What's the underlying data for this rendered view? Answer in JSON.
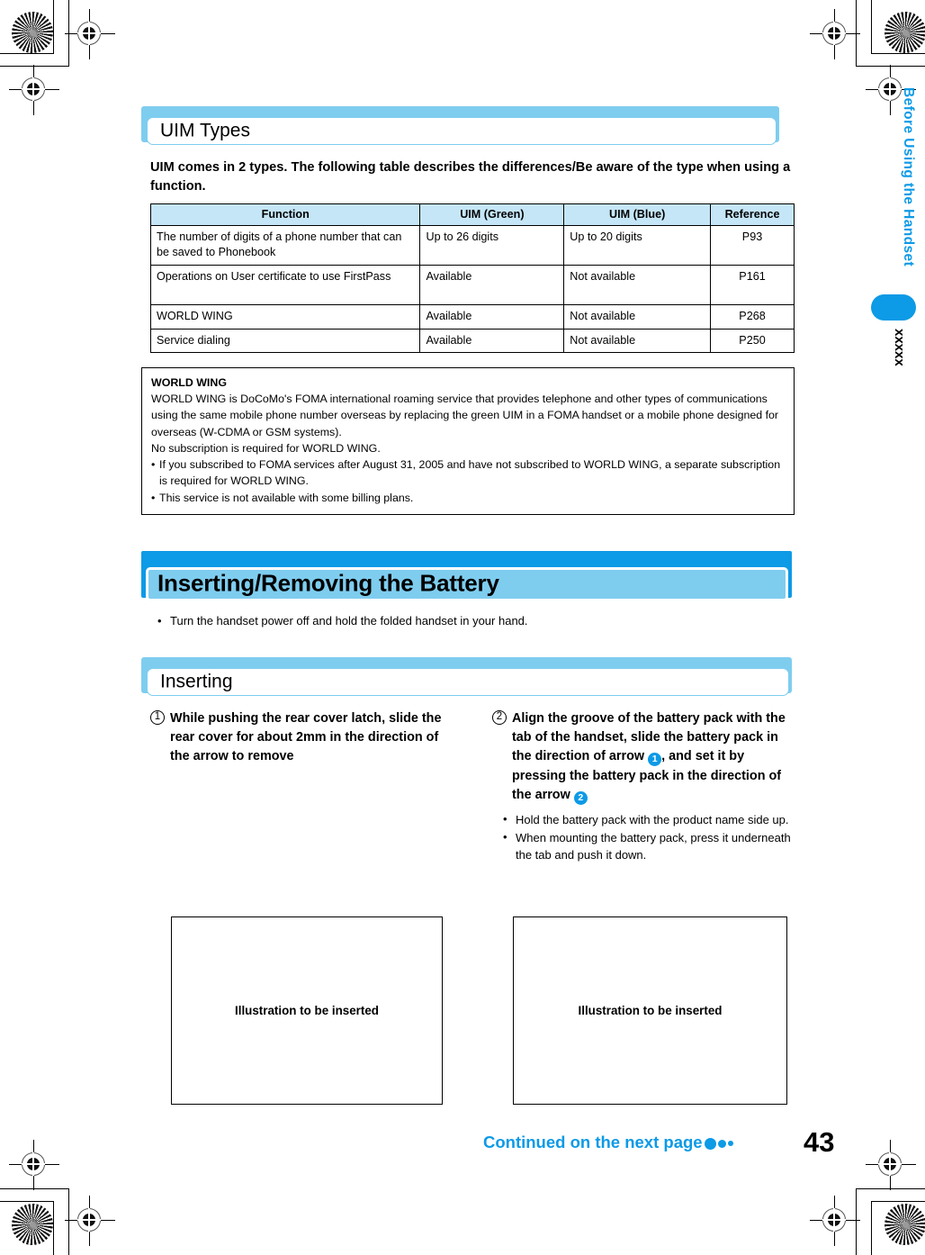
{
  "side": {
    "chapter_title": "Before Using the Handset",
    "code": "xxxxx",
    "accent_color": "#0d9ae6"
  },
  "section_uim": {
    "heading": "UIM Types",
    "intro": "UIM comes in 2 types.  The following table describes the differences/Be aware of the type when using a function.",
    "table": {
      "headers": [
        "Function",
        "UIM (Green)",
        "UIM (Blue)",
        "Reference"
      ],
      "rows": [
        [
          "The number of digits of a phone number that can be saved to Phonebook",
          "Up to 26 digits",
          "Up to 20 digits",
          "P93"
        ],
        [
          "Operations on User certificate to use FirstPass",
          "Available",
          "Not available",
          "P161"
        ],
        [
          "WORLD WING",
          "Available",
          "Not available",
          "P268"
        ],
        [
          "Service dialing",
          "Available",
          "Not available",
          "P250"
        ]
      ]
    }
  },
  "note_box": {
    "title": "WORLD WING",
    "paragraphs": [
      "WORLD WING is DoCoMo's FOMA international roaming service that provides telephone and other types of communications using the same mobile phone number overseas by replacing the green UIM in a FOMA handset or a mobile phone designed for overseas (W-CDMA or GSM systems).",
      "No subscription is required for WORLD WING."
    ],
    "bullets": [
      "If you subscribed to FOMA services after August 31, 2005 and have not subscribed to WORLD WING, a separate subscription is required for WORLD WING.",
      "This service is not available with some billing plans."
    ]
  },
  "section_battery": {
    "heading": "Inserting/Removing the Battery",
    "lead_bullet": "Turn the handset power off and hold the folded handset in your hand.",
    "sub_heading": "Inserting",
    "steps": [
      {
        "number": "1",
        "number_glyph": "①",
        "text": "While pushing the rear cover latch, slide the rear cover for about 2mm in the direction of the arrow to remove",
        "sub_bullets": [],
        "illustration_placeholder": "Illustration to be inserted"
      },
      {
        "number": "2",
        "number_glyph": "②",
        "text_part1": "Align the groove of the battery pack with the tab of the handset, slide the battery pack in the direction of arrow ",
        "inline_marker_1": "1",
        "text_part2": ", and set it by pressing the battery pack in the direction of the arrow ",
        "inline_marker_2": "2",
        "sub_bullets": [
          "Hold the battery pack with the product name side up.",
          "When mounting the battery pack, press it underneath the tab and push it down."
        ],
        "illustration_placeholder": "Illustration to be inserted"
      }
    ]
  },
  "footer": {
    "continued_label": "Continued on the next page",
    "page_number": "43"
  }
}
